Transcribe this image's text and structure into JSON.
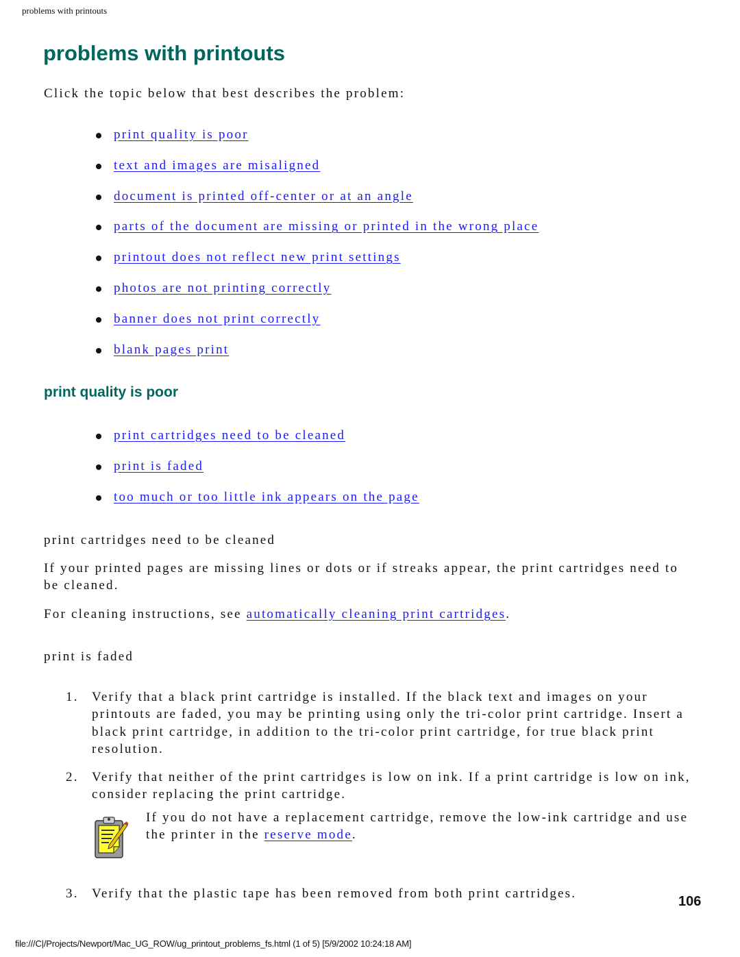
{
  "running_head": "problems with printouts",
  "title": "problems with printouts",
  "intro": "Click the topic below that best describes the problem:",
  "topics": [
    "print quality is poor",
    "text and images are misaligned",
    "document is printed off-center or at an angle",
    "parts of the document are missing or printed in the wrong place",
    "printout does not reflect new print settings",
    "photos are not printing correctly",
    "banner does not print correctly",
    "blank pages print"
  ],
  "section": {
    "heading": "print quality is poor",
    "subtopics": [
      "print cartridges need to be cleaned",
      "print is faded",
      "too much or too little ink appears on the page"
    ]
  },
  "cleaned": {
    "heading": "print cartridges need to be cleaned",
    "body": "If your printed pages are missing lines or dots or if streaks appear, the print cartridges need to be cleaned.",
    "instructions_prefix": "For cleaning instructions, see ",
    "instructions_link": "automatically cleaning print cartridges",
    "instructions_suffix": "."
  },
  "faded": {
    "heading": "print is faded",
    "steps": [
      {
        "num": "1.",
        "text": "Verify that a black print cartridge is installed. If the black text and images on your printouts are faded, you may be printing using only the tri-color print cartridge. Insert a black print cartridge, in addition to the tri-color print cartridge, for true black print resolution."
      },
      {
        "num": "2.",
        "text": "Verify that neither of the print cartridges is low on ink. If a print cartridge is low on ink, consider replacing the print cartridge."
      },
      {
        "num": "3.",
        "text": "Verify that the plastic tape has been removed from both print cartridges."
      }
    ],
    "note": {
      "icon": "note-clipboard-icon",
      "text_prefix": "If you do not have a replacement cartridge, remove the low-ink cartridge and use the printer in the ",
      "link": "reserve mode",
      "text_suffix": "."
    }
  },
  "page_number": "106",
  "footer": "file:///C|/Projects/Newport/Mac_UG_ROW/ug_printout_problems_fs.html (1 of 5) [5/9/2002 10:24:18 AM]",
  "colors": {
    "heading": "#00665e",
    "link": "#1a1aff"
  }
}
